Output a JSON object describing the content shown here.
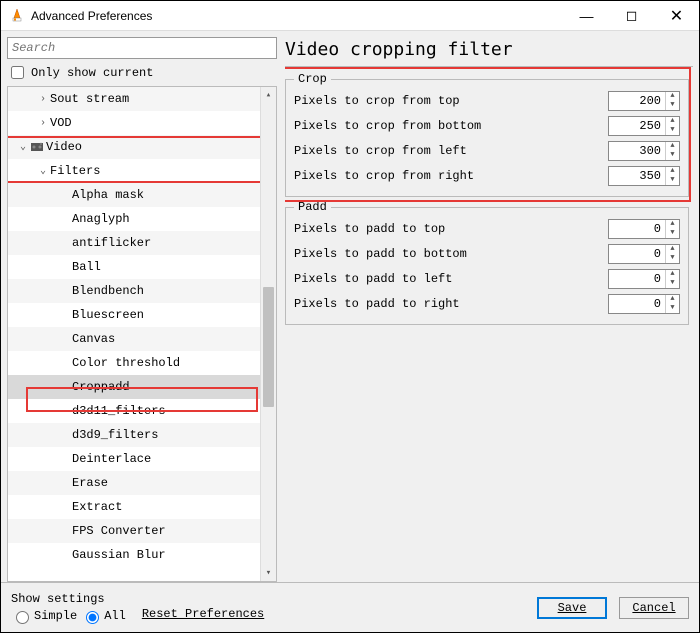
{
  "titlebar": {
    "title": "Advanced Preferences"
  },
  "search": {
    "placeholder": "Search"
  },
  "only_current_label": "Only show current",
  "tree": {
    "sout_stream": "Sout stream",
    "vod": "VOD",
    "video": "Video",
    "filters": "Filters",
    "items": [
      "Alpha mask",
      "Anaglyph",
      "antiflicker",
      "Ball",
      "Blendbench",
      "Bluescreen",
      "Canvas",
      "Color threshold",
      "Croppadd",
      "d3d11_filters",
      "d3d9_filters",
      "Deinterlace",
      "Erase",
      "Extract",
      "FPS Converter",
      "Gaussian Blur"
    ],
    "selected_index": 8
  },
  "panel": {
    "title": "Video cropping filter",
    "crop": {
      "legend": "Crop",
      "top_label": "Pixels to crop from top",
      "top_value": 200,
      "bottom_label": "Pixels to crop from bottom",
      "bottom_value": 250,
      "left_label": "Pixels to crop from left",
      "left_value": 300,
      "right_label": "Pixels to crop from right",
      "right_value": 350
    },
    "padd": {
      "legend": "Padd",
      "top_label": "Pixels to padd to top",
      "top_value": 0,
      "bottom_label": "Pixels to padd to bottom",
      "bottom_value": 0,
      "left_label": "Pixels to padd to left",
      "left_value": 0,
      "right_label": "Pixels to padd to right",
      "right_value": 0
    }
  },
  "footer": {
    "show_settings": "Show settings",
    "simple": "Simple",
    "all": "All",
    "reset": "Reset Preferences",
    "save": "Save",
    "cancel": "Cancel"
  }
}
